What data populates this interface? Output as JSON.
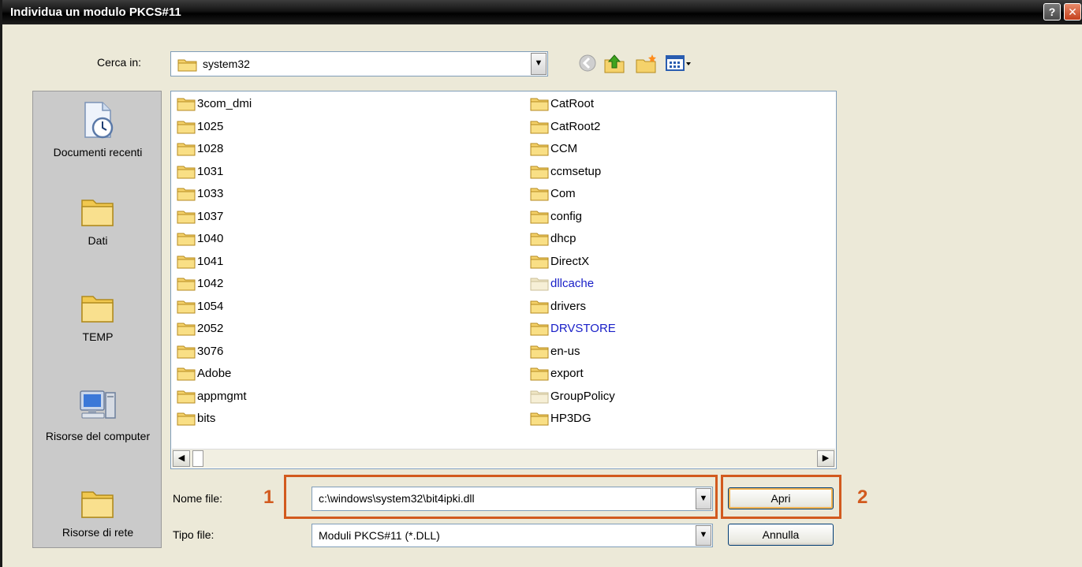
{
  "window": {
    "title": "Individua un modulo PKCS#11",
    "help_glyph": "?",
    "close_glyph": "✕"
  },
  "lookin": {
    "label": "Cerca in:",
    "value": "system32"
  },
  "places": [
    {
      "name": "Documenti recenti",
      "icon": "recent-documents-icon"
    },
    {
      "name": "Dati",
      "icon": "folder-icon"
    },
    {
      "name": "TEMP",
      "icon": "folder-icon"
    },
    {
      "name": "Risorse del computer",
      "icon": "my-computer-icon"
    },
    {
      "name": "Risorse di rete",
      "icon": "folder-icon"
    }
  ],
  "files": {
    "col1": [
      "3com_dmi",
      "1025",
      "1028",
      "1031",
      "1033",
      "1037",
      "1040",
      "1041",
      "1042",
      "1054",
      "2052",
      "3076",
      "Adobe",
      "appmgmt",
      "bits"
    ],
    "col2": [
      "CatRoot",
      "CatRoot2",
      "CCM",
      "ccmsetup",
      "Com",
      "config",
      "dhcp",
      "DirectX",
      "dllcache",
      "drivers",
      "DRVSTORE",
      "en-us",
      "export",
      "GroupPolicy",
      "HP3DG"
    ]
  },
  "filename": {
    "label": "Nome file:",
    "value": "c:\\windows\\system32\\bit4ipki.dll"
  },
  "filetype": {
    "label": "Tipo file:",
    "value": "Moduli PKCS#11 (*.DLL)"
  },
  "buttons": {
    "open": "Apri",
    "cancel": "Annulla"
  },
  "callouts": {
    "one": "1",
    "two": "2"
  },
  "colors": {
    "accent": "#d25a1e",
    "folder": "#f5d26b",
    "highlighted_text": "#1a20c8"
  }
}
